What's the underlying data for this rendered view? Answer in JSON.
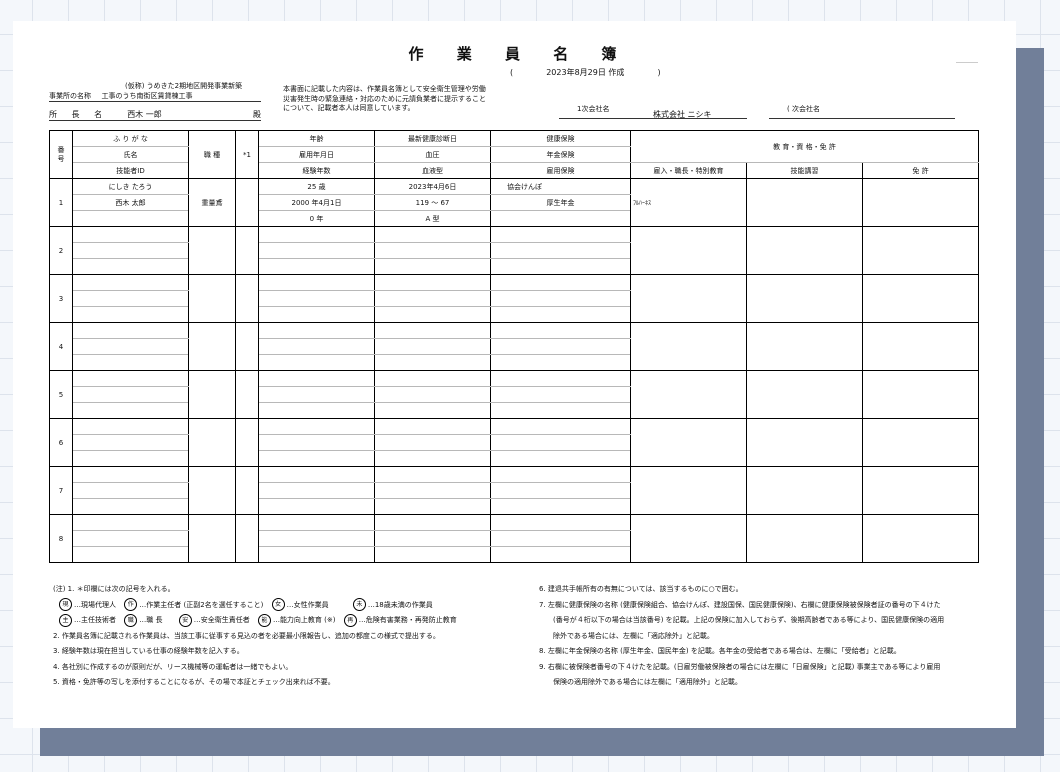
{
  "doc": {
    "title": "作 業 員 名 簿",
    "date_open": "(",
    "date": "2023年8月29日 作成",
    "date_close": ")",
    "project_label": "事業所の名称",
    "project_name_1": "(仮称) うめきた2期地区開発事業新築",
    "project_name_2": "工事のうち南街区賃貸棟工事",
    "manager_label": "所 長 名",
    "manager_name": "西木 一郎",
    "honorific": "殿",
    "consent_text_1": "本書面に記載した内容は、作業員名簿として安全衛生管理や労働",
    "consent_text_2": "災害発生時の緊急連絡・対応のために元請負業者に提示すること",
    "consent_text_3": "について、記載者本人は同意しています。",
    "company1_label": "1次会社名",
    "company1_name": "株式会社 ニシキ",
    "company2_label": "( 次会社名"
  },
  "table": {
    "header": {
      "no": "番号",
      "furigana": "ふ り が な",
      "name": "氏名",
      "tech_id": "技能者ID",
      "job": "職 種",
      "mark": "*1",
      "age": "年齢",
      "hire_date": "雇用年月日",
      "exp_years": "経験年数",
      "health_check": "最新健康診断日",
      "blood_pressure": "血圧",
      "blood_type": "血液型",
      "health_ins": "健康保険",
      "pension": "年金保険",
      "employment_ins": "雇用保険",
      "education": "教 育・資 格・免 許",
      "edu_hire": "雇入・職長・特別教育",
      "edu_skill": "技能講習",
      "edu_license": "免 許"
    },
    "rows": [
      {
        "no": "1",
        "furigana": "にしき たろう",
        "name": "西木 太郎",
        "tech_id": "",
        "job": "重量鳶",
        "mark": "",
        "age": "25 歳",
        "hire_date": "2000 年4月1日",
        "exp_years": "0 年",
        "health_check": "2023年4月6日",
        "blood_pressure": "119 ～ 67",
        "blood_type": "A 型",
        "health_ins": "協会けんぽ",
        "pension": "厚生年金",
        "employment_ins": "",
        "edu_hire": "ﾌﾙﾊｰﾈｽ",
        "edu_skill": "",
        "edu_license": ""
      },
      {
        "no": "2",
        "furigana": "",
        "name": "",
        "tech_id": "",
        "job": "",
        "mark": "",
        "age": "",
        "hire_date": "",
        "exp_years": "",
        "health_check": "",
        "blood_pressure": "",
        "blood_type": "",
        "health_ins": "",
        "pension": "",
        "employment_ins": "",
        "edu_hire": "",
        "edu_skill": "",
        "edu_license": ""
      },
      {
        "no": "3",
        "furigana": "",
        "name": "",
        "tech_id": "",
        "job": "",
        "mark": "",
        "age": "",
        "hire_date": "",
        "exp_years": "",
        "health_check": "",
        "blood_pressure": "",
        "blood_type": "",
        "health_ins": "",
        "pension": "",
        "employment_ins": "",
        "edu_hire": "",
        "edu_skill": "",
        "edu_license": ""
      },
      {
        "no": "4",
        "furigana": "",
        "name": "",
        "tech_id": "",
        "job": "",
        "mark": "",
        "age": "",
        "hire_date": "",
        "exp_years": "",
        "health_check": "",
        "blood_pressure": "",
        "blood_type": "",
        "health_ins": "",
        "pension": "",
        "employment_ins": "",
        "edu_hire": "",
        "edu_skill": "",
        "edu_license": ""
      },
      {
        "no": "5",
        "furigana": "",
        "name": "",
        "tech_id": "",
        "job": "",
        "mark": "",
        "age": "",
        "hire_date": "",
        "exp_years": "",
        "health_check": "",
        "blood_pressure": "",
        "blood_type": "",
        "health_ins": "",
        "pension": "",
        "employment_ins": "",
        "edu_hire": "",
        "edu_skill": "",
        "edu_license": ""
      },
      {
        "no": "6",
        "furigana": "",
        "name": "",
        "tech_id": "",
        "job": "",
        "mark": "",
        "age": "",
        "hire_date": "",
        "exp_years": "",
        "health_check": "",
        "blood_pressure": "",
        "blood_type": "",
        "health_ins": "",
        "pension": "",
        "employment_ins": "",
        "edu_hire": "",
        "edu_skill": "",
        "edu_license": ""
      },
      {
        "no": "7",
        "furigana": "",
        "name": "",
        "tech_id": "",
        "job": "",
        "mark": "",
        "age": "",
        "hire_date": "",
        "exp_years": "",
        "health_check": "",
        "blood_pressure": "",
        "blood_type": "",
        "health_ins": "",
        "pension": "",
        "employment_ins": "",
        "edu_hire": "",
        "edu_skill": "",
        "edu_license": ""
      },
      {
        "no": "8",
        "furigana": "",
        "name": "",
        "tech_id": "",
        "job": "",
        "mark": "",
        "age": "",
        "hire_date": "",
        "exp_years": "",
        "health_check": "",
        "blood_pressure": "",
        "blood_type": "",
        "health_ins": "",
        "pension": "",
        "employment_ins": "",
        "edu_hire": "",
        "edu_skill": "",
        "edu_license": ""
      }
    ]
  },
  "notes": {
    "n1": "(注) 1. ＊印欄には次の記号を入れる。",
    "m1_sym": "現",
    "m1_text": "…現場代理人",
    "m2_sym": "作",
    "m2_text": "…作業主任者 (正副2名を選任すること)",
    "m3_sym": "女",
    "m3_text": "…女性作業員",
    "m4_sym": "未",
    "m4_text": "…18歳未満の作業員",
    "m5_sym": "主",
    "m5_text": "…主任技術者",
    "m6_sym": "職",
    "m6_text": "…職 長",
    "m7_sym": "安",
    "m7_text": "…安全衛生責任者",
    "m8_sym": "能",
    "m8_text": "…能力向上教育 (※)",
    "m9_sym": "再",
    "m9_text": "…危険有害業務・再発防止教育",
    "n2": "2. 作業員名簿に記載される作業員は、当該工事に従事する見込の者を必要最小限報告し、追加の都度この様式で提出する。",
    "n3": "3. 経験年数は現在担当している仕事の経験年数を記入する。",
    "n4": "4. 各社別に作成するのが原則だが、リース機械等の運転者は一緒でもよい。",
    "n5": "5. 資格・免許等の写しを添付することになるが、その場で本証とチェック出来れば不要。",
    "n6": "6. 建退共手帳所有の有無については、該当するものに○で囲む。",
    "n7a": "7. 左欄に健康保険の名称 (健康保険組合、協会けんぽ、建設国保、国民健康保険)、右欄に健康保険被保険者証の番号の下４けた",
    "n7b": "(番号が４桁以下の場合は当該番号) を記載。上記の保険に加入しておらず、後期高齢者である等により、国民健康保険の適用",
    "n7c": "除外である場合には、左欄に「適応除外」と記載。",
    "n8": "8. 左欄に年金保険の名称 (厚生年金、国民年金) を記載。各年金の受給者である場合は、左欄に「受給者」と記載。",
    "n9a": "9. 右欄に被保険者番号の下４けたを記載。(日雇労働被保険者の場合には左欄に「日雇保険」と記載) 事業主である等により雇用",
    "n9b": "保険の適用除外である場合には左欄に「適用除外」と記載。"
  }
}
